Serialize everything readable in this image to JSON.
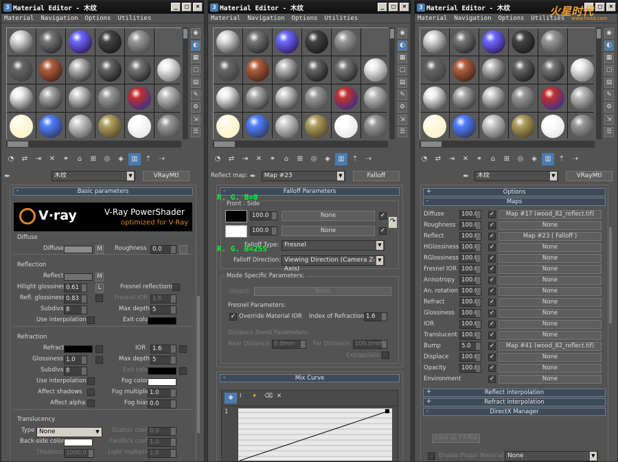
{
  "windows": [
    {
      "title": "Material Editor - 木纹"
    },
    {
      "title": "Material Editor - 木纹"
    },
    {
      "title": "Material Editor - 木纹"
    }
  ],
  "menu": [
    "Material",
    "Navigation",
    "Options",
    "Utilities"
  ],
  "watermark": {
    "main": "火星时代",
    "sub": "www.hxsd.com"
  },
  "name_row": {
    "material_name": "木纹",
    "type_vray": "VRayMtl",
    "reflect_label": "Reflect map:",
    "map_name": "Map #23",
    "type_falloff": "Falloff"
  },
  "left": {
    "rollout": "Basic parameters",
    "banner": {
      "logo": "V·ray",
      "title": "V-Ray PowerShader",
      "subtitle": "optimized for V-Ray"
    },
    "diffuse": {
      "group": "Diffuse",
      "label": "Diffuse",
      "m": "M",
      "rough_label": "Roughness",
      "rough": "0.0"
    },
    "reflection": {
      "group": "Reflection",
      "reflect": "Reflect",
      "m": "M",
      "hilight_label": "Hilight glossiness",
      "hilight": "0.61",
      "l": "L",
      "fresnel_label": "Fresnel reflections",
      "refl_gloss_label": "Refl. glossiness",
      "refl_gloss": "0.83",
      "fresnel_ior_label": "Fresnel IOR",
      "fresnel_ior": "1.6",
      "subdivs_label": "Subdivs",
      "subdivs": "8",
      "max_depth_label": "Max depth",
      "max_depth": "5",
      "use_interp": "Use interpolation",
      "exit_color": "Exit color"
    },
    "refraction": {
      "group": "Refraction",
      "refract": "Refract",
      "ior_label": "IOR",
      "ior": "1.6",
      "gloss_label": "Glossiness",
      "gloss": "1.0",
      "max_depth_label": "Max depth",
      "max_depth": "5",
      "subdivs_label": "Subdivs",
      "subdivs": "8",
      "exit_color": "Exit color",
      "use_interp": "Use interpolation",
      "fog_color": "Fog color",
      "affect_shadows": "Affect shadows",
      "fog_mult_label": "Fog multiplier",
      "fog_mult": "1.0",
      "affect_alpha": "Affect alpha",
      "fog_bias_label": "Fog bias",
      "fog_bias": "0.0"
    },
    "translucency": {
      "group": "Translucency",
      "type_label": "Type",
      "type": "None",
      "scatter_label": "Scatter coeff",
      "scatter": "0.0",
      "backside_label": "Back-side color",
      "fwdbck_label": "Fwd/bck coeff",
      "fwdbck": "1.0",
      "thickness_label": "Thickness",
      "thickness": "1000.0",
      "light_mult_label": "Light multiplier",
      "light_mult": "1.0"
    }
  },
  "middle": {
    "rollout": "Falloff Parameters",
    "annot1": "R. G. B=0",
    "annot2": "R. G. B=255",
    "front_side": "Front : Side",
    "pct1": "100.0",
    "none1": "None",
    "pct2": "100.0",
    "none2": "None",
    "falloff_type_label": "Falloff Type:",
    "falloff_type": "Fresnel",
    "falloff_dir_label": "Falloff Direction:",
    "falloff_dir": "Viewing Direction (Camera Z-Axis)",
    "mode_group": "Mode Specific Parameters:",
    "object_label": "Object:",
    "object": "None",
    "fresnel_group": "Fresnel Parameters:",
    "override_ior": "Override Material IOR",
    "ior_label": "Index of Refraction",
    "ior": "1.6",
    "distance_group": "Distance Blend Parameters:",
    "near_label": "Near Distance:",
    "near": "0.0mm",
    "far_label": "Far Distance:",
    "far": "100.0mm",
    "extrapolate": "Extrapolate",
    "mix_curve": "Mix Curve",
    "curve_point": "1"
  },
  "right": {
    "options": "Options",
    "maps": "Maps",
    "rows": [
      {
        "name": "Diffuse",
        "amt": "100.0",
        "map": "Map #17 (wood_82_reflect.tif)"
      },
      {
        "name": "Roughness",
        "amt": "100.0",
        "map": "None"
      },
      {
        "name": "Reflect",
        "amt": "100.0",
        "map": "Map #23  ( Falloff )"
      },
      {
        "name": "HGlossiness",
        "amt": "100.0",
        "map": "None"
      },
      {
        "name": "RGlossiness",
        "amt": "100.0",
        "map": "None"
      },
      {
        "name": "Fresnel IOR",
        "amt": "100.0",
        "map": "None"
      },
      {
        "name": "Anisotropy",
        "amt": "100.0",
        "map": "None"
      },
      {
        "name": "An. rotation",
        "amt": "100.0",
        "map": "None"
      },
      {
        "name": "Refract",
        "amt": "100.0",
        "map": "None"
      },
      {
        "name": "Glossiness",
        "amt": "100.0",
        "map": "None"
      },
      {
        "name": "IOR",
        "amt": "100.0",
        "map": "None"
      },
      {
        "name": "Translucent",
        "amt": "100.0",
        "map": "None"
      },
      {
        "name": "Bump",
        "amt": "5.0",
        "map": "Map #41 (wood_82_reflect.tif)"
      },
      {
        "name": "Displace",
        "amt": "100.0",
        "map": "None"
      },
      {
        "name": "Opacity",
        "amt": "100.0",
        "map": "None"
      },
      {
        "name": "Environment",
        "amt": "",
        "map": "None"
      }
    ],
    "reflect_interp": "Reflect interpolation",
    "refract_interp": "Refract interpolation",
    "directx": "DirectX Manager",
    "save_fx": "Save as FX File",
    "enable_plugin": "Enable Plugin Material",
    "plugin": "None"
  }
}
